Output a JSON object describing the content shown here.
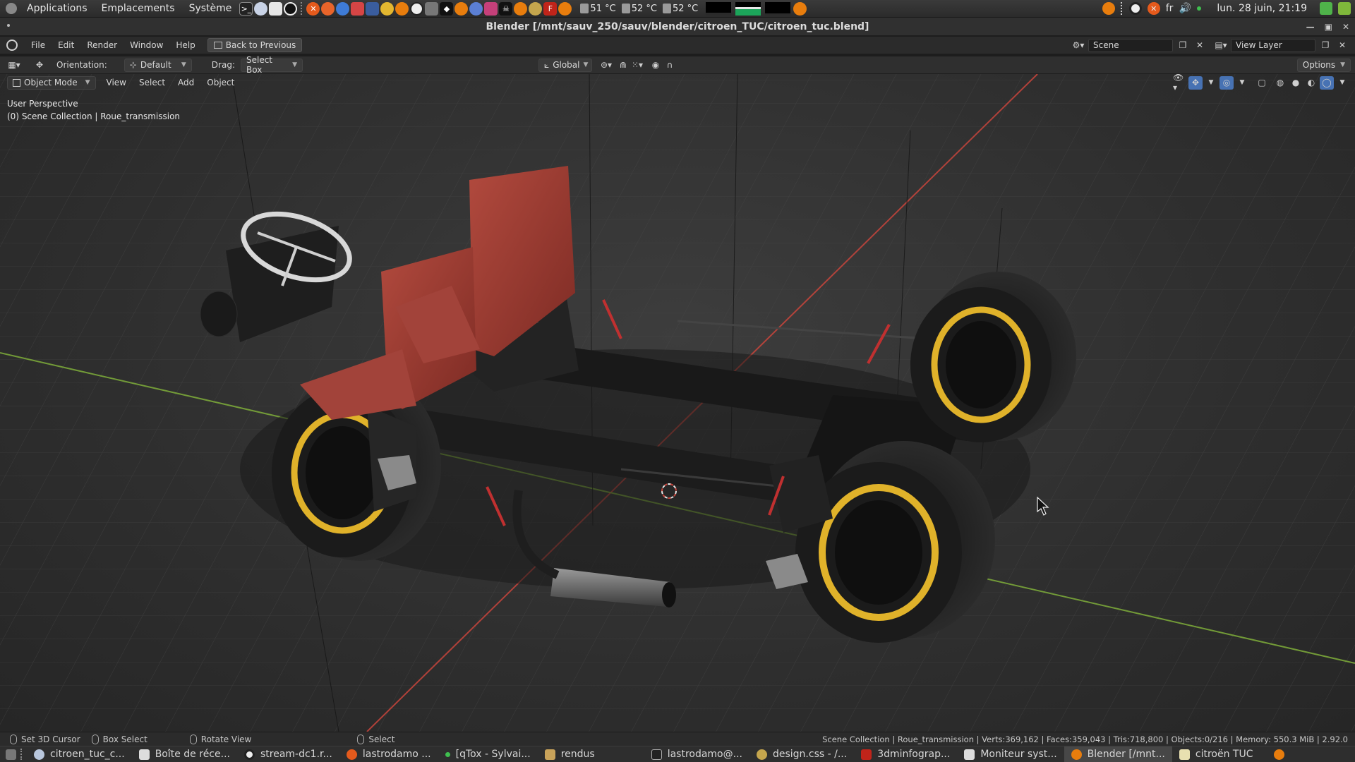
{
  "top_panel": {
    "menus": [
      "Applications",
      "Emplacements",
      "Système"
    ],
    "temps": [
      "51 °C",
      "52 °C",
      "52 °C"
    ],
    "keyboard_layout": "fr",
    "clock": "lun. 28 juin, 21:19"
  },
  "window": {
    "title": "Blender [/mnt/sauv_250/sauv/blender/citroen_TUC/citroen_tuc.blend]"
  },
  "topbar": {
    "menus": [
      "File",
      "Edit",
      "Render",
      "Window",
      "Help"
    ],
    "back_button": "Back to Previous",
    "scene": "Scene",
    "view_layer": "View Layer"
  },
  "tool_header": {
    "orientation_label": "Orientation:",
    "orientation_value": "Default",
    "drag_label": "Drag:",
    "drag_value": "Select Box",
    "transform_orientation": "Global",
    "options": "Options"
  },
  "viewport_header": {
    "mode": "Object Mode",
    "menus": [
      "View",
      "Select",
      "Add",
      "Object"
    ]
  },
  "viewport": {
    "perspective": "User Perspective",
    "collection": "(0) Scene Collection | Roue_transmission"
  },
  "statusbar": {
    "hints": [
      "Set 3D Cursor",
      "Box Select",
      "Rotate View",
      "Select"
    ],
    "stats": "Scene Collection | Roue_transmission | Verts:369,162 | Faces:359,043 | Tris:718,800 | Objects:0/216 | Memory: 550.3 MiB | 2.92.0"
  },
  "taskbar": {
    "tasks": [
      "citroen_tuc_c...",
      "Boîte de réce...",
      "stream-dc1.r...",
      "lastrodamo ...",
      "[qTox - Sylvai...",
      "rendus",
      "lastrodamo@...",
      "design.css - /...",
      "3dminfograp...",
      "Moniteur syst...",
      "Blender [/mnt...",
      "citroën TUC"
    ],
    "active_index": 10
  },
  "colors": {
    "accent": "#4772b3",
    "x_axis": "#c8453c",
    "y_axis": "#7fae3a",
    "seat": "#9e3a30",
    "rim": "#e0b22a"
  }
}
